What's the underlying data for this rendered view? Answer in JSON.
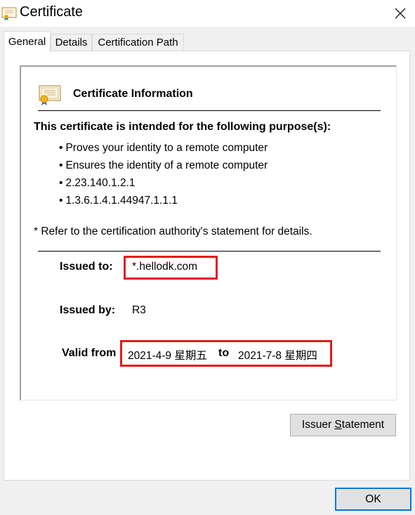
{
  "window": {
    "title": "Certificate",
    "close_icon": "close-icon"
  },
  "tabs": [
    {
      "label": "General",
      "active": true
    },
    {
      "label": "Details",
      "active": false
    },
    {
      "label": "Certification Path",
      "active": false
    }
  ],
  "general": {
    "heading": "Certificate Information",
    "purpose_heading": "This certificate is intended for the following purpose(s):",
    "purposes": [
      "Proves your identity to a remote computer",
      "Ensures the identity of a remote computer",
      "2.23.140.1.2.1",
      "1.3.6.1.4.1.44947.1.1.1"
    ],
    "note": "* Refer to the certification authority's statement for details.",
    "issued_to_label": "Issued to:",
    "issued_to": "*.hellodk.com",
    "issued_by_label": "Issued by:",
    "issued_by": "R3",
    "valid_from_label": "Valid from",
    "valid_from": "2021-4-9 星期五",
    "to_label": "to",
    "valid_to": "2021-7-8 星期四",
    "highlight_color": "#e21b1b"
  },
  "buttons": {
    "issuer_statement_pre": "Issuer ",
    "issuer_statement_accel": "S",
    "issuer_statement_post": "tatement",
    "ok": "OK"
  }
}
